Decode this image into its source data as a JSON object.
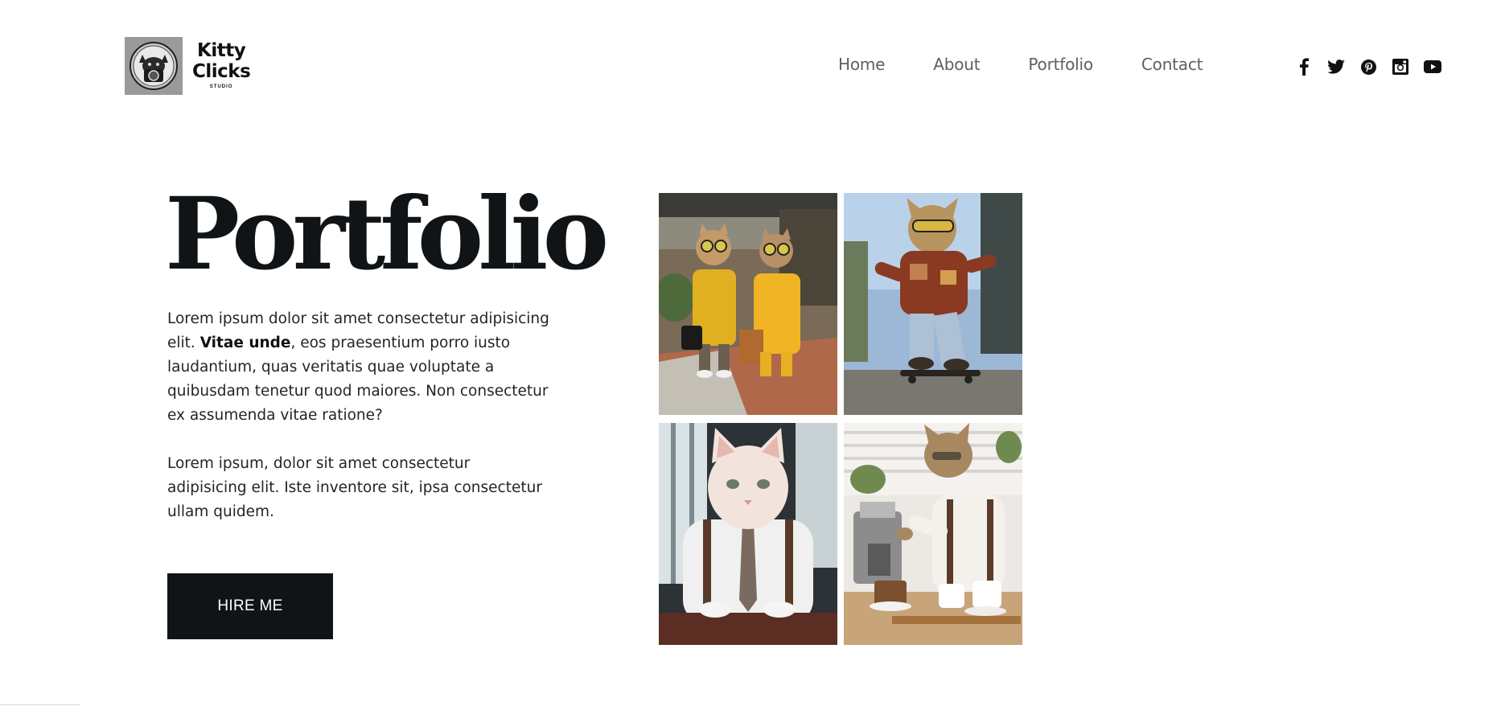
{
  "logo": {
    "name_line1": "Kitty",
    "name_line2": "Clicks",
    "sub": "STUDIO",
    "icon": "cat-camera-logo"
  },
  "nav": {
    "items": [
      {
        "label": "Home"
      },
      {
        "label": "About"
      },
      {
        "label": "Portfolio"
      },
      {
        "label": "Contact"
      }
    ]
  },
  "social": {
    "icons": [
      "facebook-icon",
      "twitter-icon",
      "pinterest-icon",
      "instagram-icon",
      "youtube-icon"
    ]
  },
  "hero": {
    "title": "Portfolio",
    "para1_lead": "Lorem ipsum dolor sit amet consectetur adipisicing elit. ",
    "para1_bold": "Vitae unde",
    "para1_rest": ", eos praesentium porro iusto laudantium, quas veritatis quae voluptate a quibusdam tenetur quod maiores. Non consectetur ex assumenda vitae ratione?",
    "para2": "Lorem ipsum, dolor sit amet consectetur adipisicing elit. Iste inventore sit, ipsa consectetur ullam quidem.",
    "cta_label": "HIRE ME"
  },
  "gallery": {
    "images": [
      "cats-in-yellow-raincoats",
      "cat-skateboarding",
      "cat-in-business-suit",
      "cat-barista"
    ]
  },
  "colors": {
    "text_dark": "#101416",
    "nav_gray": "#5d6063",
    "button_bg": "#101416",
    "button_text": "#ffffff"
  }
}
